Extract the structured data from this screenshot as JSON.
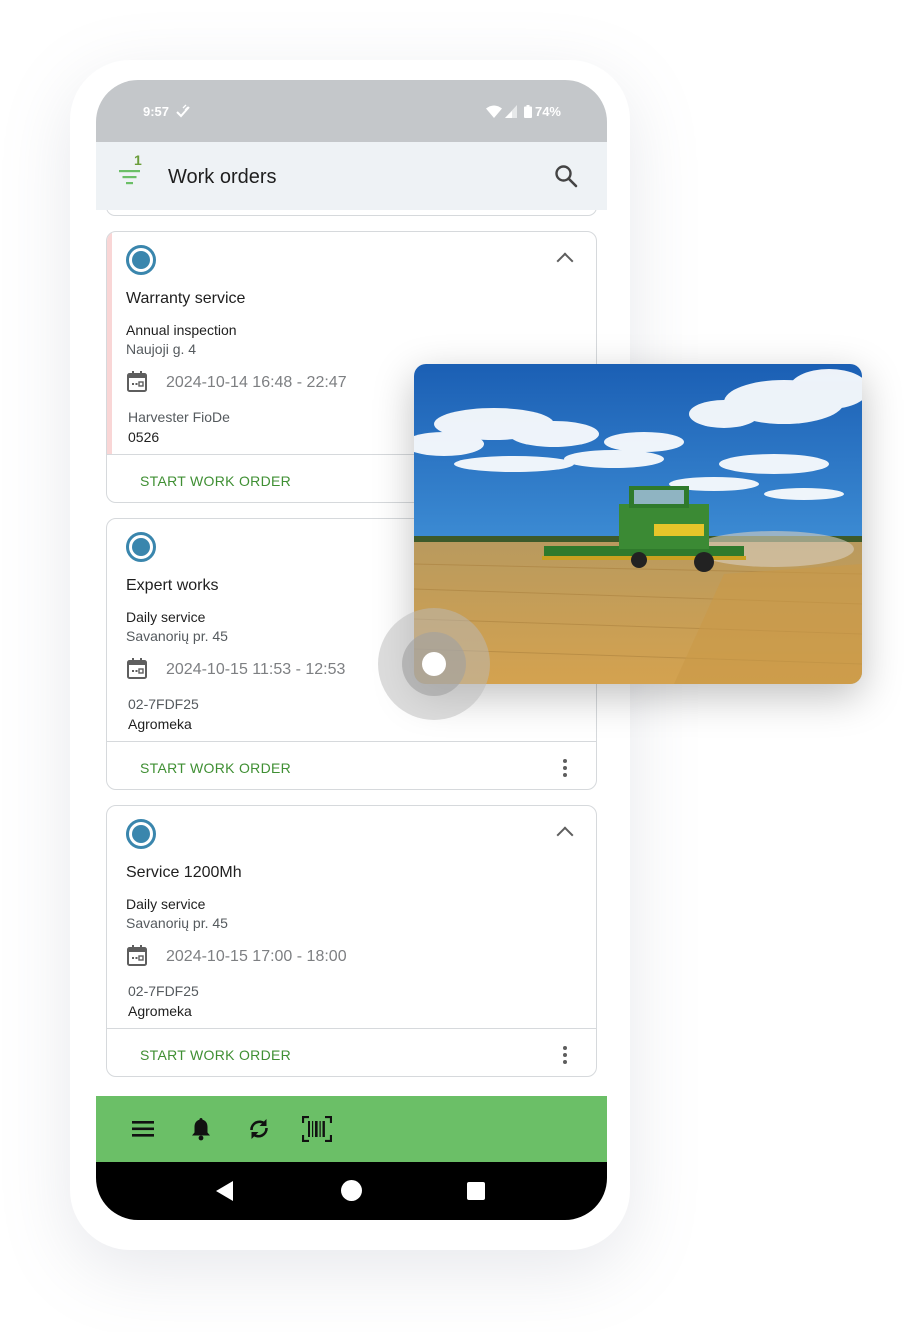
{
  "status_bar": {
    "time": "9:57",
    "battery": "74%",
    "icons": [
      "notification-icon",
      "wifi-icon",
      "signal-icon",
      "battery-icon"
    ]
  },
  "app_bar": {
    "title": "Work orders",
    "filter_count": "1",
    "icons": [
      "filter-icon",
      "search-icon"
    ]
  },
  "work_orders": [
    {
      "title": "Warranty service",
      "type": "Annual inspection",
      "address": "Naujoji g. 4",
      "datetime": "2024-10-14 16:48 - 22:47",
      "machine": "Harvester FioDe",
      "serial": "0526",
      "action": "START WORK ORDER",
      "status_color": "#3a86ad",
      "accent_color": "#f9d6d6"
    },
    {
      "title": "Expert works",
      "type": "Daily service",
      "address": "Savanorių pr. 45",
      "datetime": "2024-10-15 11:53 - 12:53",
      "machine": "02-7FDF25",
      "serial": "Agromeka",
      "action": "START WORK ORDER",
      "status_color": "#3a86ad"
    },
    {
      "title": "Service 1200Mh",
      "type": "Daily service",
      "address": "Savanorių pr. 45",
      "datetime": "2024-10-15 17:00 - 18:00",
      "machine": "02-7FDF25",
      "serial": "Agromeka",
      "action": "START WORK ORDER",
      "status_color": "#3a86ad"
    }
  ],
  "bottom_bar": {
    "items": [
      "menu-icon",
      "bell-icon",
      "sync-icon",
      "barcode-icon"
    ],
    "color": "#6bbf67"
  },
  "nav_bar": {
    "items": [
      "back-button",
      "home-button",
      "recents-button"
    ]
  },
  "colors": {
    "accent_green": "#3f8f33",
    "status_blue": "#3a86ad"
  }
}
